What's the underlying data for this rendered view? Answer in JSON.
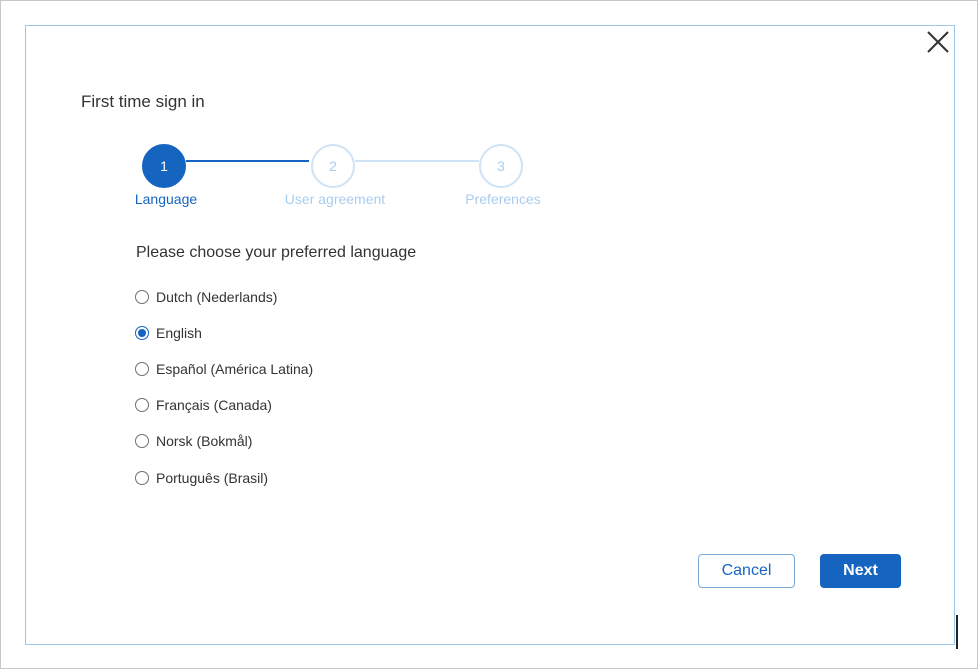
{
  "dialog": {
    "title": "First time sign in",
    "close_icon": "close-icon"
  },
  "stepper": {
    "steps": [
      {
        "number": "1",
        "label": "Language",
        "state": "active"
      },
      {
        "number": "2",
        "label": "User agreement",
        "state": "inactive"
      },
      {
        "number": "3",
        "label": "Preferences",
        "state": "inactive"
      }
    ]
  },
  "language": {
    "prompt": "Please choose your preferred language",
    "selected": "English",
    "options": [
      {
        "label": "Dutch (Nederlands)",
        "checked": false
      },
      {
        "label": "English",
        "checked": true
      },
      {
        "label": "Español (América Latina)",
        "checked": false
      },
      {
        "label": "Français (Canada)",
        "checked": false
      },
      {
        "label": "Norsk (Bokmål)",
        "checked": false
      },
      {
        "label": "Português (Brasil)",
        "checked": false
      }
    ]
  },
  "footer": {
    "cancel_label": "Cancel",
    "next_label": "Next"
  },
  "colors": {
    "accent": "#1565c0",
    "inactive_step": "#a9cdef",
    "dialog_border": "#9cc7e8"
  }
}
